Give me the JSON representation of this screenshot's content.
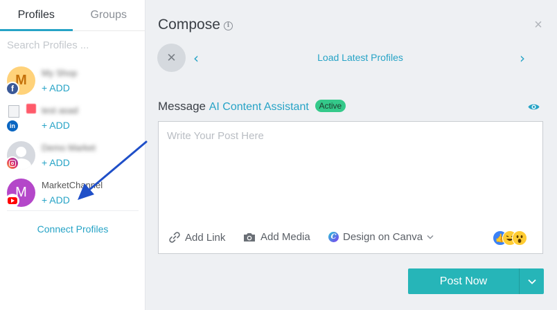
{
  "sidebar": {
    "tabs": [
      {
        "label": "Profiles",
        "active": true
      },
      {
        "label": "Groups",
        "active": false
      }
    ],
    "search_placeholder": "Search Profiles ...",
    "profiles": [
      {
        "name": "My Shop",
        "name_blurred": true,
        "add_label": "+ ADD",
        "avatar_letter": "M",
        "network": "facebook",
        "network_glyph": "f"
      },
      {
        "name": "test asad",
        "name_blurred": true,
        "add_label": "+ ADD",
        "avatar_letter": "",
        "network": "linkedin",
        "network_glyph": "in"
      },
      {
        "name": "Demo Market",
        "name_blurred": true,
        "add_label": "+ ADD",
        "avatar_letter": "",
        "network": "instagram",
        "network_glyph": ""
      },
      {
        "name": "MarketChannel",
        "name_blurred": false,
        "add_label": "+ ADD",
        "avatar_letter": "M",
        "network": "youtube",
        "network_glyph": ""
      }
    ],
    "connect_label": "Connect Profiles"
  },
  "compose": {
    "title": "Compose",
    "info_glyph": "i",
    "close_glyph": "×",
    "clear_glyph": "✕",
    "prev_glyph": "‹",
    "next_glyph": "›",
    "load_latest_label": "Load Latest Profiles",
    "message_label": "Message",
    "ai_assistant_label": "AI Content Assistant",
    "ai_status_badge": "Active",
    "editor_placeholder": "Write Your Post Here",
    "tools": {
      "add_link": "Add Link",
      "add_media": "Add Media",
      "design_canva": "Design on Canva",
      "canva_glyph": "C"
    },
    "reaction_like_glyph": "👍",
    "post_now_label": "Post Now"
  },
  "colors": {
    "accent": "#26a3c6",
    "post_button": "#26b5b8",
    "active_badge": "#34c98a",
    "annotation_arrow": "#1f4fc8"
  },
  "icons": [
    "info-icon",
    "close-icon",
    "chevron-left-icon",
    "chevron-right-icon",
    "eye-icon",
    "link-icon",
    "camera-icon",
    "canva-icon",
    "chevron-down-icon",
    "facebook-icon",
    "linkedin-icon",
    "instagram-icon",
    "youtube-icon"
  ]
}
